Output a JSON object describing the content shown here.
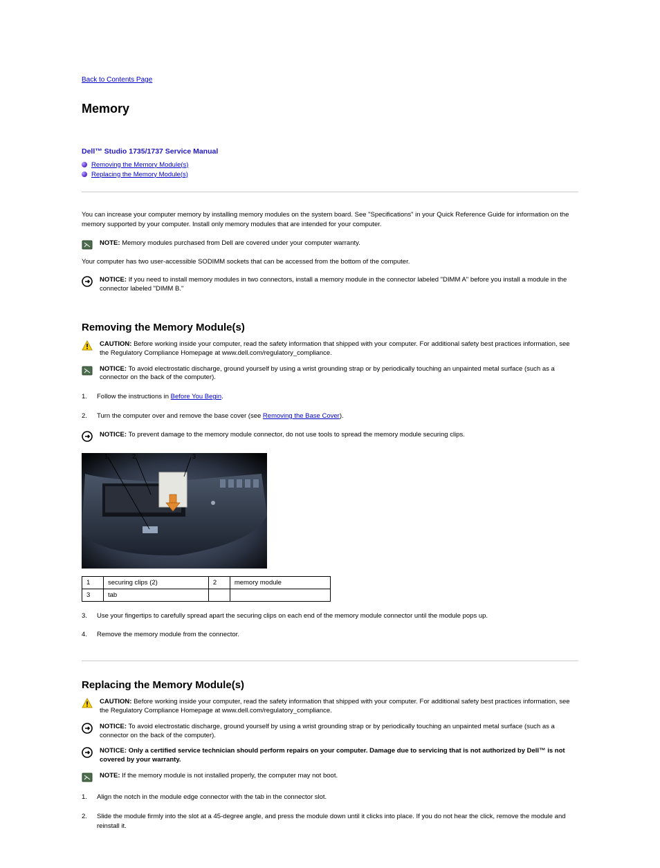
{
  "top_link": "Back to Contents Page",
  "page_section_title": "Memory",
  "manual_title": "Dell™ Studio 1735/1737 Service Manual",
  "toc": [
    "Removing the Memory Module(s)",
    "Replacing the Memory Module(s)"
  ],
  "intro": "You can increase your computer memory by installing memory modules on the system board. See \"Specifications\" in your Quick Reference Guide for information on the memory supported by your computer. Install only memory modules that are intended for your computer.",
  "note_dell_memory": "Memory modules purchased from Dell are covered under your computer warranty.",
  "memory_slots_line": "Your computer has two user-accessible SODIMM sockets that can be accessed from the bottom of the computer.",
  "notice_dimm_b": "If you need to install memory modules in two connectors, install a memory module in the connector labeled \"DIMM A\" before you install a module in the connector labeled \"DIMM B.\"",
  "remove_heading": "Removing the Memory Module(s)",
  "caution_text": "Before working inside your computer, read the safety information that shipped with your computer. For additional safety best practices information, see the Regulatory Compliance Homepage at www.dell.com/regulatory_compliance.",
  "notice_esd": "To avoid electrostatic discharge, ground yourself by using a wrist grounding strap or by periodically touching an unpainted metal surface (such as a connector on the back of the computer).",
  "remove_steps": [
    {
      "text_before": "Follow the instructions in ",
      "link": "Before You Begin",
      "text_after": "."
    },
    {
      "text_before": "Turn the computer over and remove the base cover (see ",
      "link": "Removing the Base Cover",
      "text_after": ")."
    }
  ],
  "notice_tools": "To prevent damage to the memory module connector, do not use tools to spread the memory module securing clips.",
  "parts": {
    "r1c1": "1",
    "r1c2": "securing clips (2)",
    "r1c3": "2",
    "r1c4": "memory module",
    "r2c1": "3",
    "r2c2": "tab"
  },
  "remove_steps_2": [
    "Use your fingertips to carefully spread apart the securing clips on each end of the memory module connector until the module pops up.",
    "Remove the memory module from the connector."
  ],
  "replace_heading": "Replacing the Memory Module(s)",
  "notice_only_cert": "Only a certified service technician should perform repairs on your computer. Damage due to servicing that is not authorized by Dell™ is not covered by your warranty.",
  "note_align": "If the memory module is not installed properly, the computer may not boot.",
  "replace_steps": [
    "Align the notch in the module edge connector with the tab in the connector slot.",
    "Slide the module firmly into the slot at a 45-degree angle, and press the module down until it clicks into place. If you do not hear the click, remove the module and reinstall it."
  ],
  "labels": {
    "caution": "CAUTION:",
    "notice": "NOTICE:",
    "note": "NOTE:"
  },
  "chart_data": null
}
